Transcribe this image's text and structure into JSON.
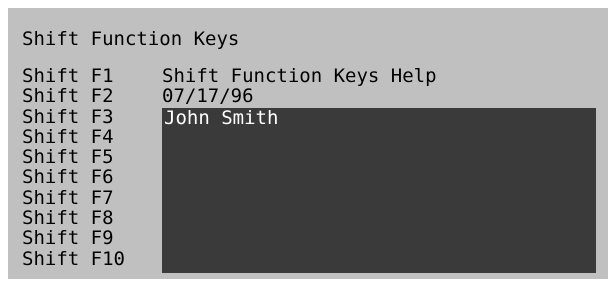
{
  "title": "Shift Function Keys",
  "keys": [
    {
      "label": "Shift F1"
    },
    {
      "label": "Shift F2"
    },
    {
      "label": "Shift F3"
    },
    {
      "label": "Shift F4"
    },
    {
      "label": "Shift F5"
    },
    {
      "label": "Shift F6"
    },
    {
      "label": "Shift F7"
    },
    {
      "label": "Shift F8"
    },
    {
      "label": "Shift F9"
    },
    {
      "label": "Shift F10"
    }
  ],
  "values": {
    "f1": "Shift Function Keys Help",
    "f2": "07/17/96",
    "f3": "John Smith"
  },
  "colors": {
    "background": "#c0c0c0",
    "text": "#000000",
    "field_background": "#3a3a3a",
    "field_text": "#ffffff"
  }
}
